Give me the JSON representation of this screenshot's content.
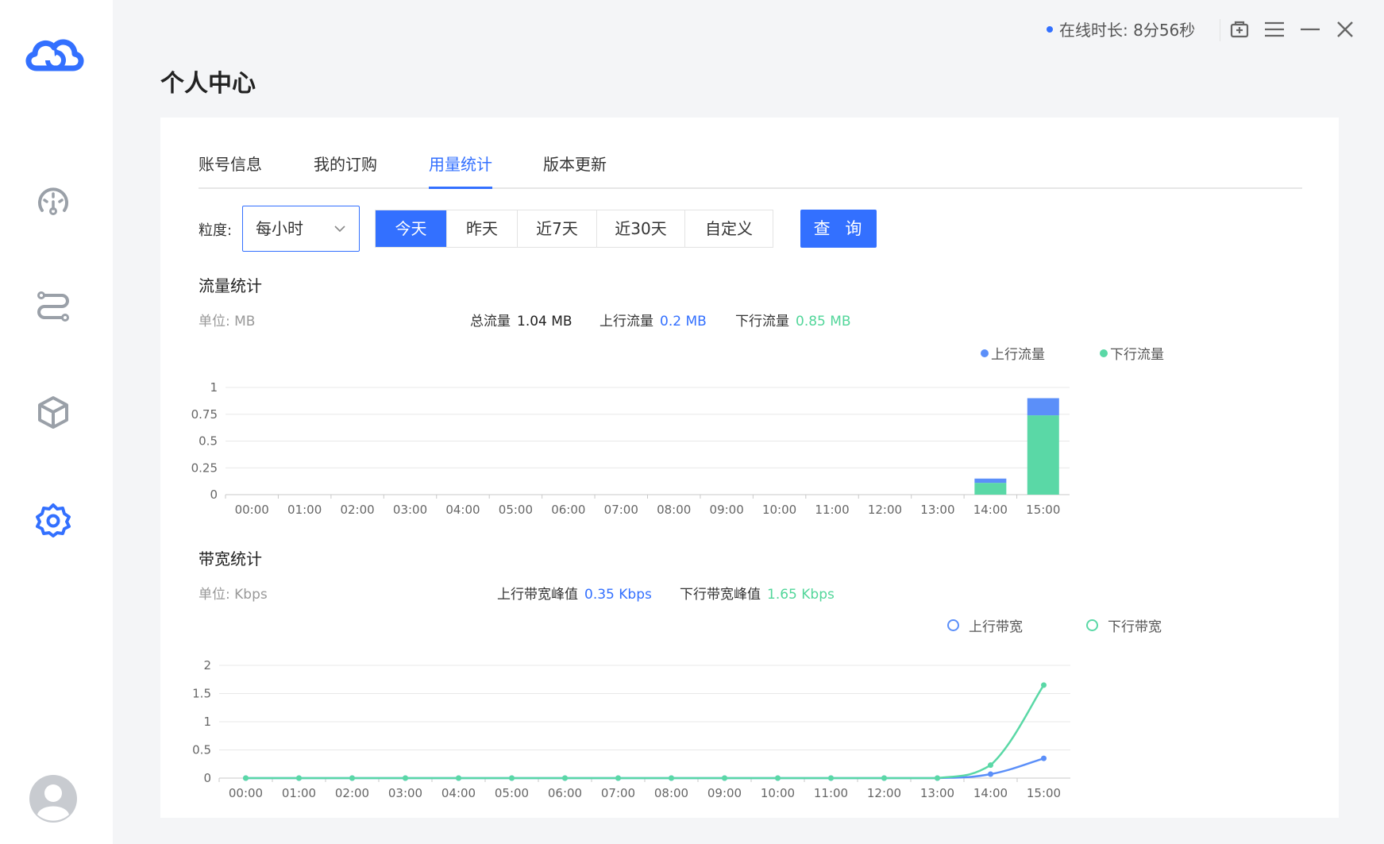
{
  "topbar": {
    "online_label": "在线时长: 8分56秒",
    "icons": [
      "gift-icon",
      "menu-icon",
      "minimize-icon",
      "close-icon"
    ]
  },
  "sidebar": {
    "icons": [
      "cloud-logo-icon",
      "speedometer-icon",
      "route-icon",
      "cube-icon",
      "gear-icon",
      "avatar-icon"
    ],
    "accent": "#3370ff"
  },
  "page": {
    "title": "个人中心"
  },
  "tabs": [
    {
      "label": "账号信息"
    },
    {
      "label": "我的订购"
    },
    {
      "label": "用量统计",
      "active": true
    },
    {
      "label": "版本更新"
    }
  ],
  "filters": {
    "granularity_label": "粒度:",
    "granularity_value": "每小时",
    "ranges": [
      "今天",
      "昨天",
      "近7天",
      "近30天",
      "自定义"
    ],
    "active_range": "今天",
    "query_label": "查 询"
  },
  "traffic": {
    "title": "流量统计",
    "unit": "单位: MB",
    "total_label": "总流量",
    "total_value": "1.04 MB",
    "up_label": "上行流量",
    "up_value": "0.2 MB",
    "down_label": "下行流量",
    "down_value": "0.85 MB"
  },
  "bandwidth": {
    "title": "带宽统计",
    "unit": "单位: Kbps",
    "up_peak_label": "上行带宽峰值",
    "up_peak_value": "0.35 Kbps",
    "down_peak_label": "下行带宽峰值",
    "down_peak_value": "1.65 Kbps"
  },
  "colors": {
    "up": "#5b8ff9",
    "down": "#5ad8a6",
    "primary": "#3370ff"
  },
  "chart_data": [
    {
      "type": "bar",
      "stacked": true,
      "categories": [
        "00:00",
        "01:00",
        "02:00",
        "03:00",
        "04:00",
        "05:00",
        "06:00",
        "07:00",
        "08:00",
        "09:00",
        "10:00",
        "11:00",
        "12:00",
        "13:00",
        "14:00",
        "15:00"
      ],
      "series": [
        {
          "name": "下行流量",
          "values": [
            0,
            0,
            0,
            0,
            0,
            0,
            0,
            0,
            0,
            0,
            0,
            0,
            0,
            0,
            0.11,
            0.74
          ]
        },
        {
          "name": "上行流量",
          "values": [
            0,
            0,
            0,
            0,
            0,
            0,
            0,
            0,
            0,
            0,
            0,
            0,
            0,
            0,
            0.04,
            0.16
          ]
        }
      ],
      "yticks": [
        "0",
        "0.25",
        "0.5",
        "0.75",
        "1"
      ],
      "ylim": [
        0,
        1
      ],
      "legend": "top-right",
      "grid": true
    },
    {
      "type": "line",
      "categories": [
        "00:00",
        "01:00",
        "02:00",
        "03:00",
        "04:00",
        "05:00",
        "06:00",
        "07:00",
        "08:00",
        "09:00",
        "10:00",
        "11:00",
        "12:00",
        "13:00",
        "14:00",
        "15:00"
      ],
      "series": [
        {
          "name": "上行带宽",
          "values": [
            0,
            0,
            0,
            0,
            0,
            0,
            0,
            0,
            0,
            0,
            0,
            0,
            0,
            0,
            0.07,
            0.35
          ]
        },
        {
          "name": "下行带宽",
          "values": [
            0,
            0,
            0,
            0,
            0,
            0,
            0,
            0,
            0,
            0,
            0,
            0,
            0,
            0,
            0.23,
            1.65
          ]
        }
      ],
      "yticks": [
        "0",
        "0.5",
        "1",
        "1.5",
        "2"
      ],
      "ylim": [
        0,
        2
      ],
      "legend": "top-right",
      "grid": true
    }
  ]
}
